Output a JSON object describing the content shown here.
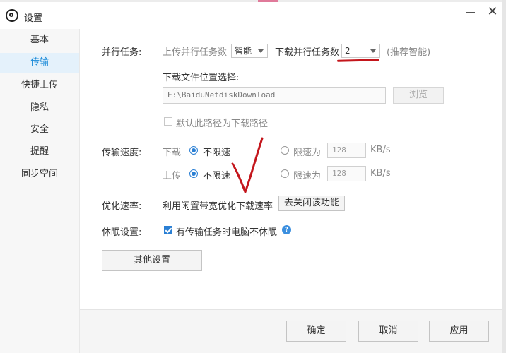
{
  "window": {
    "title": "设置",
    "app_icon": "baidu-netdisk-icon"
  },
  "sidebar": {
    "items": [
      {
        "label": "基本",
        "active": false
      },
      {
        "label": "传输",
        "active": true
      },
      {
        "label": "快捷上传",
        "active": false
      },
      {
        "label": "隐私",
        "active": false
      },
      {
        "label": "安全",
        "active": false
      },
      {
        "label": "提醒",
        "active": false
      },
      {
        "label": "同步空间",
        "active": false
      }
    ]
  },
  "parallel": {
    "label": "并行任务:",
    "upload_label": "上传并行任务数",
    "upload_value": "智能",
    "download_label": "下载并行任务数",
    "download_value": "2",
    "hint": "(推荐智能)"
  },
  "download_location": {
    "label": "下载文件位置选择:",
    "path": "E:\\BaiduNetdiskDownload",
    "browse_label": "浏览",
    "default_checkbox_label": "默认此路径为下载路径",
    "default_checked": false
  },
  "speed": {
    "label": "传输速度:",
    "download": {
      "label": "下载",
      "unlimited_label": "不限速",
      "limit_label": "限速为",
      "limit_value": "128",
      "unit": "KB/s",
      "selected": "unlimited"
    },
    "upload": {
      "label": "上传",
      "unlimited_label": "不限速",
      "limit_label": "限速为",
      "limit_value": "128",
      "unit": "KB/s",
      "selected": "unlimited"
    }
  },
  "optimize": {
    "label": "优化速率:",
    "text": "利用闲置带宽优化下载速率",
    "button_label": "去关闭该功能"
  },
  "sleep": {
    "label": "休眠设置:",
    "checkbox_label": "有传输任务时电脑不休眠",
    "checked": true
  },
  "other_settings_label": "其他设置",
  "footer": {
    "ok_label": "确定",
    "cancel_label": "取消",
    "apply_label": "应用"
  },
  "colors": {
    "accent": "#1a8ad8",
    "active_bg": "#e4f1fb",
    "annotation": "#c4161c"
  }
}
